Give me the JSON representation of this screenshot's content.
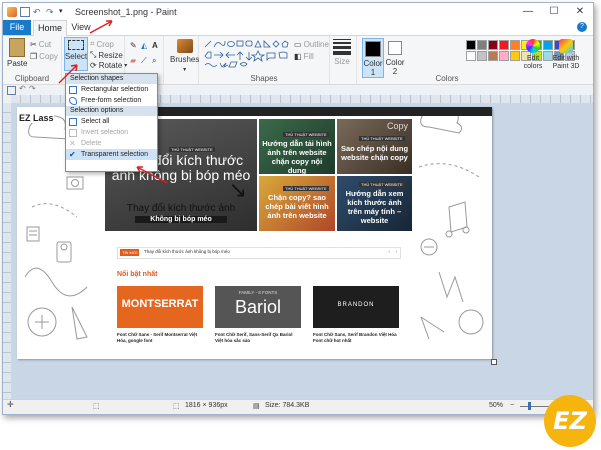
{
  "window": {
    "title": "Screenshot_1.png - Paint"
  },
  "tabs": {
    "file": "File",
    "home": "Home",
    "view": "View"
  },
  "clipboard": {
    "paste": "Paste",
    "cut": "Cut",
    "copy": "Copy",
    "label": "Clipboard"
  },
  "image": {
    "select": "Select",
    "crop": "Crop",
    "resize": "Resize",
    "rotate": "Rotate"
  },
  "tools": {
    "brushes": "Brushes"
  },
  "shapes": {
    "outline": "Outline",
    "fill": "Fill",
    "label": "Shapes"
  },
  "size": {
    "label": "Size"
  },
  "colors": {
    "color1": "Color 1",
    "color2": "Color 2",
    "edit": "Edit colors",
    "paint3d": "Edit with Paint 3D",
    "label": "Colors",
    "palette": [
      "#000000",
      "#7f7f7f",
      "#880015",
      "#ed1c24",
      "#ff7f27",
      "#fff200",
      "#22b14c",
      "#00a2e8",
      "#3f48cc",
      "#a349a4",
      "#ffffff",
      "#c3c3c3",
      "#b97a57",
      "#ffaec9",
      "#ffc90e",
      "#efe4b0",
      "#b5e61d",
      "#99d9ea",
      "#7092be",
      "#c8bfe7"
    ]
  },
  "dropdown": {
    "shapes_header": "Selection shapes",
    "rect": "Rectangular selection",
    "free": "Free-form selection",
    "options_header": "Selection options",
    "select_all": "Select all",
    "invert": "Invert selection",
    "delete": "Delete",
    "transparent": "Transparent selection"
  },
  "canvas": {
    "hero_title": "Thay đổi kích thước ảnh không bị bóp méo",
    "hero_sub": "Thay đổi kích thước ảnh",
    "hero_sub2": "Không bị bóp méo",
    "tile1": "Hướng dẫn tải hình ảnh trên website chặn copy nội dung",
    "tile2": "Sao chép nội dung website chặn copy",
    "tile3": "Chặn copy? sao chép bài viết hình ảnh trên website",
    "tile4": "Hướng dẫn xem kích thước ảnh trên máy tính – website",
    "tile2_label": "Copy",
    "tag": "THỦ THUẬT WEBSITE",
    "ticker_label": "TIN MỚI",
    "ticker": "Thay đổi kích thước ảnh không bị bóp méo",
    "featured": "Nổi bật nhất",
    "font1_img": "MONTSERRAT",
    "font2_top": "FAMILY - 8 FONTS",
    "font2_img": "Bariol",
    "font3_img": "BRANDON",
    "font1": "Font Chữ Sans - Serif Montserrat Việt Hóa, google font",
    "font2": "Font Chữ Serif, Sans-Serif Qx Bariol Việt hóa sắc sảo",
    "font3": "Font Chữ Sans, Serif Brandon Việt Hóa Font chữ hot nhất",
    "logo": "EZ Lass",
    "date": "Wednesday, January 22"
  },
  "status": {
    "dimensions": "1816 × 936px",
    "size": "Size: 784.3KB",
    "zoom": "50%"
  },
  "watermark": "EZ"
}
